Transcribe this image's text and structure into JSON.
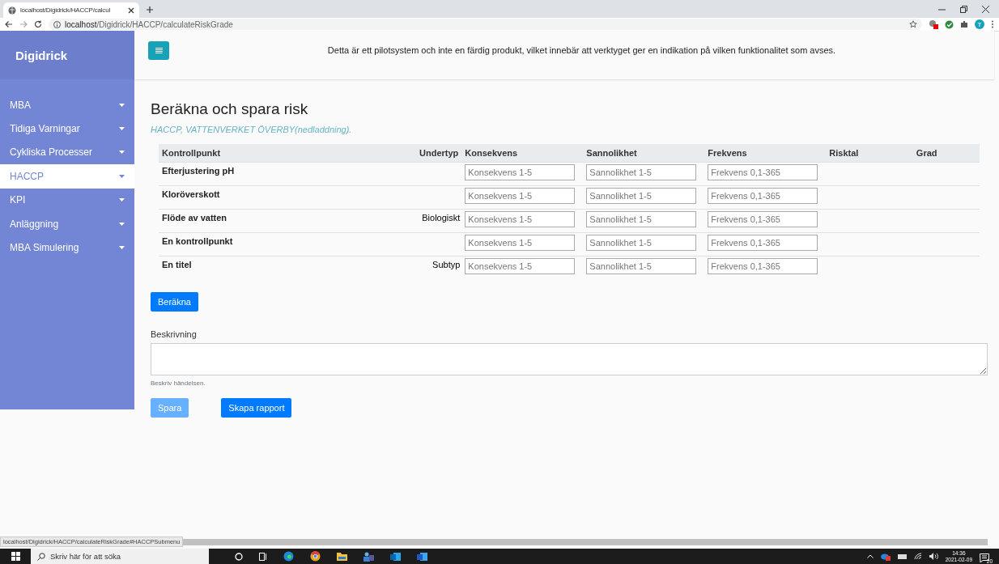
{
  "browser": {
    "tab_title": "localhost/Digidrick/HACCP/calcul",
    "url_host": "localhost",
    "url_path": "/Digidrick/HACCP/calculateRiskGrade",
    "profile_initial": "T"
  },
  "sidebar": {
    "brand": "Digidrick",
    "items": [
      {
        "label": "MBA",
        "selected": false
      },
      {
        "label": "Tidiga Varningar",
        "selected": false
      },
      {
        "label": "Cykliska Processer",
        "selected": false
      },
      {
        "label": "HACCP",
        "selected": true
      },
      {
        "label": "KPI",
        "selected": false
      },
      {
        "label": "Anläggning",
        "selected": false
      },
      {
        "label": "MBA Simulering",
        "selected": false
      }
    ]
  },
  "notice": "Detta är ett pilotsystem och inte en färdig produkt, vilket innebär att verktyget ger en indikation på vilken funktionalitet som avses.",
  "page": {
    "title": "Beräkna och spara risk",
    "subtitle": "HACCP, VATTENVERKET ÖVERBY(nedladdning)."
  },
  "table": {
    "columns": [
      "Kontrollpunkt",
      "Undertyp",
      "Konsekvens",
      "Sannolikhet",
      "Frekvens",
      "Risktal",
      "Grad"
    ],
    "rows": [
      {
        "kontrollpunkt": "Efterjustering pH",
        "konsekvens_placeholder": "Konsekvens 1-5",
        "sannolikhet_placeholder": "Sannolikhet 1-5",
        "frekvens_placeholder": "Frekvens 0,1-365"
      },
      {
        "kontrollpunkt": "Kloröverskott",
        "konsekvens_placeholder": "Konsekvens 1-5",
        "sannolikhet_placeholder": "Sannolikhet 1-5",
        "frekvens_placeholder": "Frekvens 0,1-365"
      },
      {
        "kontrollpunkt": "Flöde av vatten",
        "undertyp": "Biologiskt",
        "konsekvens_placeholder": "Konsekvens 1-5",
        "sannolikhet_placeholder": "Sannolikhet 1-5",
        "frekvens_placeholder": "Frekvens 0,1-365"
      },
      {
        "kontrollpunkt": "En kontrollpunkt",
        "konsekvens_placeholder": "Konsekvens 1-5",
        "sannolikhet_placeholder": "Sannolikhet 1-5",
        "frekvens_placeholder": "Frekvens 0,1-365"
      },
      {
        "kontrollpunkt": "En titel",
        "undertyp": "Subtyp",
        "konsekvens_placeholder": "Konsekvens 1-5",
        "sannolikhet_placeholder": "Sannolikhet 1-5",
        "frekvens_placeholder": "Frekvens 0,1-365"
      }
    ]
  },
  "calculate_button": "Beräkna",
  "description": {
    "label": "Beskrivning",
    "help": "Beskriv händelsen."
  },
  "buttons": [
    {
      "label": "Spara",
      "disabled": true
    },
    {
      "label": "Skapa rapport",
      "disabled": false
    }
  ],
  "status_url": "localhost/Digidrick/HACCP/calculateRiskGrade#HACCPSubmenu",
  "taskbar": {
    "search_placeholder": "Skriv här för att söka",
    "time": "14:36",
    "date": "2021-02-09",
    "notification_count": "20"
  }
}
